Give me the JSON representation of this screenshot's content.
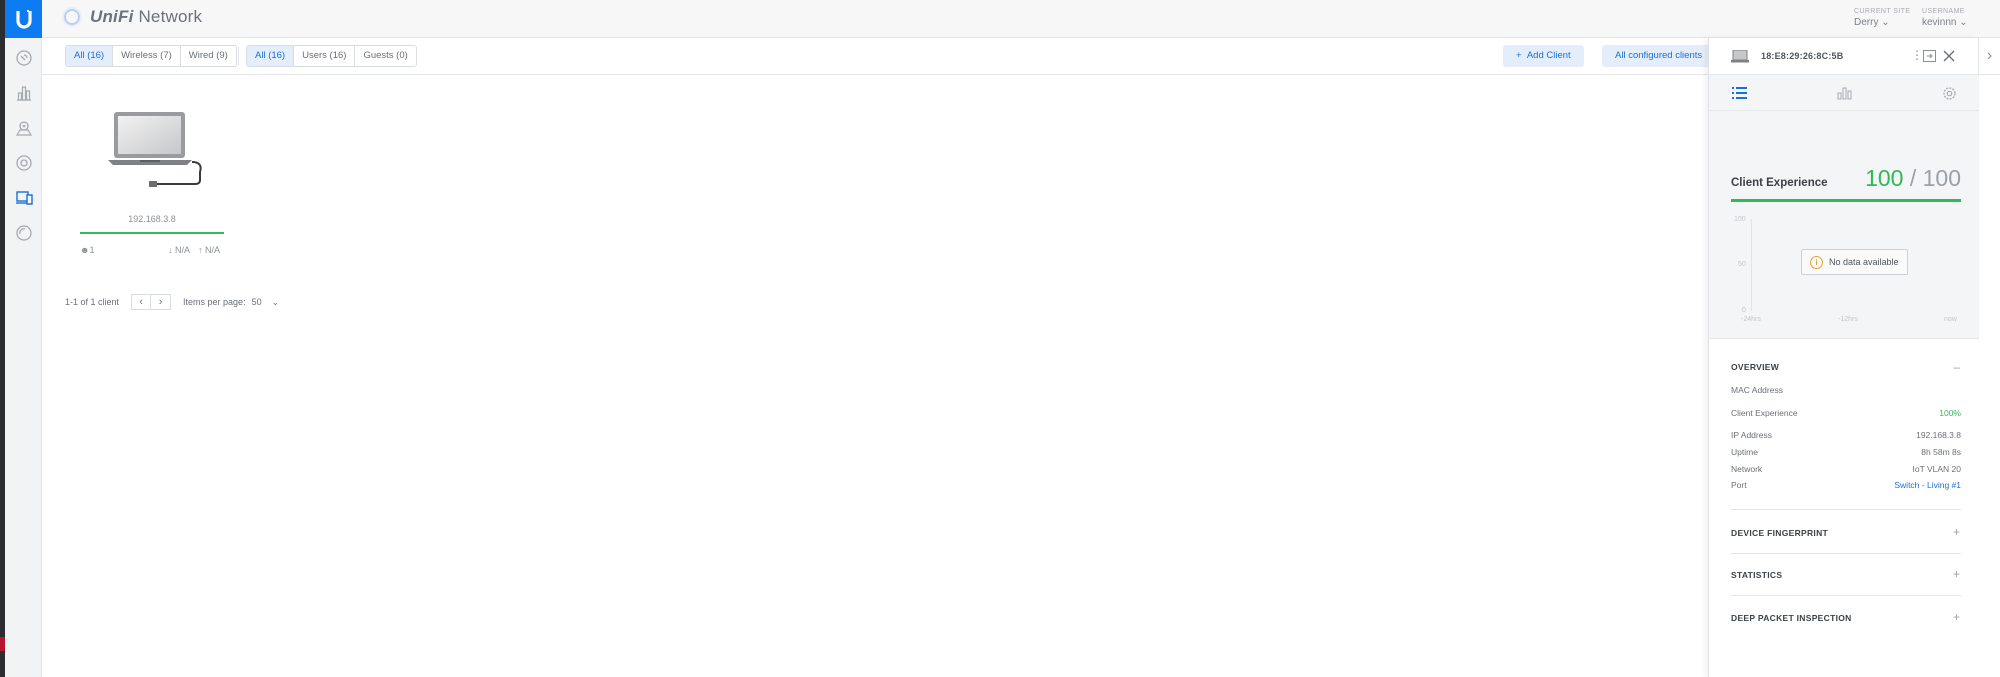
{
  "app": {
    "brand_prefix": "UniFi",
    "brand_suffix": "Network"
  },
  "header": {
    "site_label": "CURRENT SITE",
    "site_value": "Derry",
    "user_label": "USERNAME",
    "user_value": "kevinnn"
  },
  "sidebar": {
    "items": [
      {
        "icon": "dashboard-icon"
      },
      {
        "icon": "statistics-icon"
      },
      {
        "icon": "map-icon"
      },
      {
        "icon": "devices-icon"
      },
      {
        "icon": "clients-icon",
        "active": true
      },
      {
        "icon": "insights-icon"
      }
    ]
  },
  "filters": {
    "connection": [
      "All (16)",
      "Wireless (7)",
      "Wired (9)"
    ],
    "type": [
      "All (16)",
      "Users (16)",
      "Guests (0)"
    ],
    "add_client": "Add Client",
    "all_configured": "All configured clients"
  },
  "client": {
    "ip": "192.168.3.8",
    "users": "1",
    "down": "N/A",
    "up": "N/A"
  },
  "pagination": {
    "summary": "1-1 of 1 client",
    "items_per_page_label": "Items per page:",
    "items_per_page": "50"
  },
  "panel": {
    "mac": "18:E8:29:26:8C:5B",
    "client_experience_title": "Client Experience",
    "score": "100",
    "score_max": "/ 100",
    "chart": {
      "y_labels": [
        "100",
        "50",
        "0"
      ],
      "x_labels": [
        "-24hrs",
        "-12hrs",
        "now"
      ],
      "no_data": "No data available"
    },
    "overview": {
      "title": "OVERVIEW",
      "rows": {
        "mac_label": "MAC Address",
        "ce_label": "Client Experience",
        "ce_value": "100%",
        "ip_label": "IP Address",
        "ip_value": "192.168.3.8",
        "uptime_label": "Uptime",
        "uptime_value": "8h 58m 8s",
        "network_label": "Network",
        "network_value": "IoT VLAN 20",
        "port_label": "Port",
        "port_value": "Switch - Living #1"
      }
    },
    "sections": [
      "DEVICE FINGERPRINT",
      "STATISTICS",
      "DEEP PACKET INSPECTION"
    ]
  },
  "colors": {
    "accent": "#1b6fd8",
    "brand": "#0d7cf2",
    "good": "#30b956",
    "warning": "#e0a23a"
  }
}
